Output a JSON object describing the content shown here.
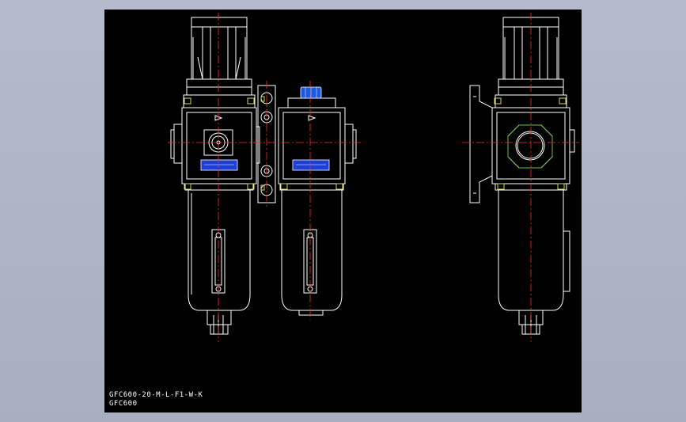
{
  "viewer": {
    "background_color": "#aab2c4",
    "canvas_color": "#000000"
  },
  "drawing": {
    "line_color": "#ffffff",
    "centerline_color": "#ff2a2a",
    "nameplate_color": "#1e3fd1",
    "accent_green": "#6bbf3a",
    "accent_yellow": "#d8d84a",
    "plug_blue": "#1a5be0",
    "title_line_1": "GFC600-20-M-L-F1-W-K",
    "title_line_2": "GFC600"
  }
}
